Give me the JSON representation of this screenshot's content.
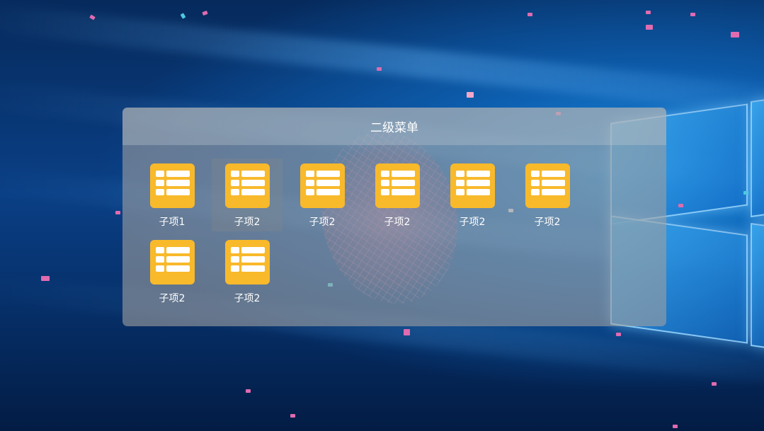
{
  "panel": {
    "title": "二级菜单"
  },
  "items": [
    {
      "label": "子项1",
      "icon": "table-list-icon"
    },
    {
      "label": "子项2",
      "icon": "table-list-icon"
    },
    {
      "label": "子项2",
      "icon": "table-list-icon"
    },
    {
      "label": "子项2",
      "icon": "table-list-icon"
    },
    {
      "label": "子项2",
      "icon": "table-list-icon"
    },
    {
      "label": "子项2",
      "icon": "table-list-icon"
    },
    {
      "label": "子项2",
      "icon": "table-list-icon"
    },
    {
      "label": "子项2",
      "icon": "table-list-icon"
    }
  ],
  "colors": {
    "icon_background": "#f8b92b",
    "label_text": "#ffffff",
    "panel_overlay": "rgba(160,160,160,0.6)"
  }
}
